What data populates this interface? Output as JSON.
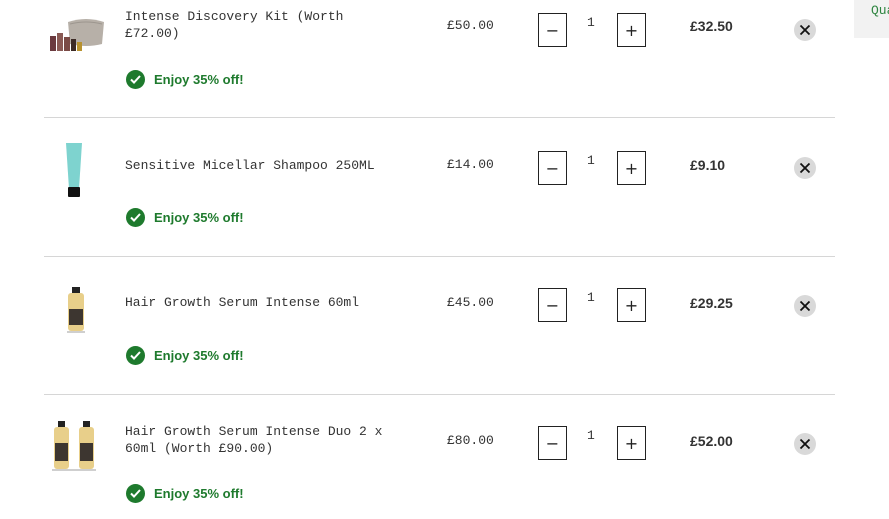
{
  "side_panel": {
    "label": "Qua"
  },
  "items": [
    {
      "thumb_icon": "discovery-kit-product-image",
      "name": "Intense Discovery Kit (Worth £72.00)",
      "price": "£50.00",
      "quantity": "1",
      "total": "£32.50",
      "promo": "Enjoy 35% off!"
    },
    {
      "thumb_icon": "shampoo-tube-product-image",
      "name": "Sensitive Micellar Shampoo 250ML",
      "price": "£14.00",
      "quantity": "1",
      "total": "£9.10",
      "promo": "Enjoy 35% off!"
    },
    {
      "thumb_icon": "serum-bottle-product-image",
      "name": "Hair Growth Serum Intense 60ml",
      "price": "£45.00",
      "quantity": "1",
      "total": "£29.25",
      "promo": "Enjoy 35% off!"
    },
    {
      "thumb_icon": "serum-duo-product-image",
      "name": "Hair Growth Serum Intense Duo 2 x 60ml (Worth £90.00)",
      "price": "£80.00",
      "quantity": "1",
      "total": "£52.00",
      "promo": "Enjoy 35% off!"
    }
  ],
  "controls": {
    "minus_symbol": "−",
    "plus_symbol": "+"
  },
  "colors": {
    "promo_green": "#1e7a2d",
    "remove_bg": "#d9d9d9",
    "divider": "#d6d6d6"
  }
}
